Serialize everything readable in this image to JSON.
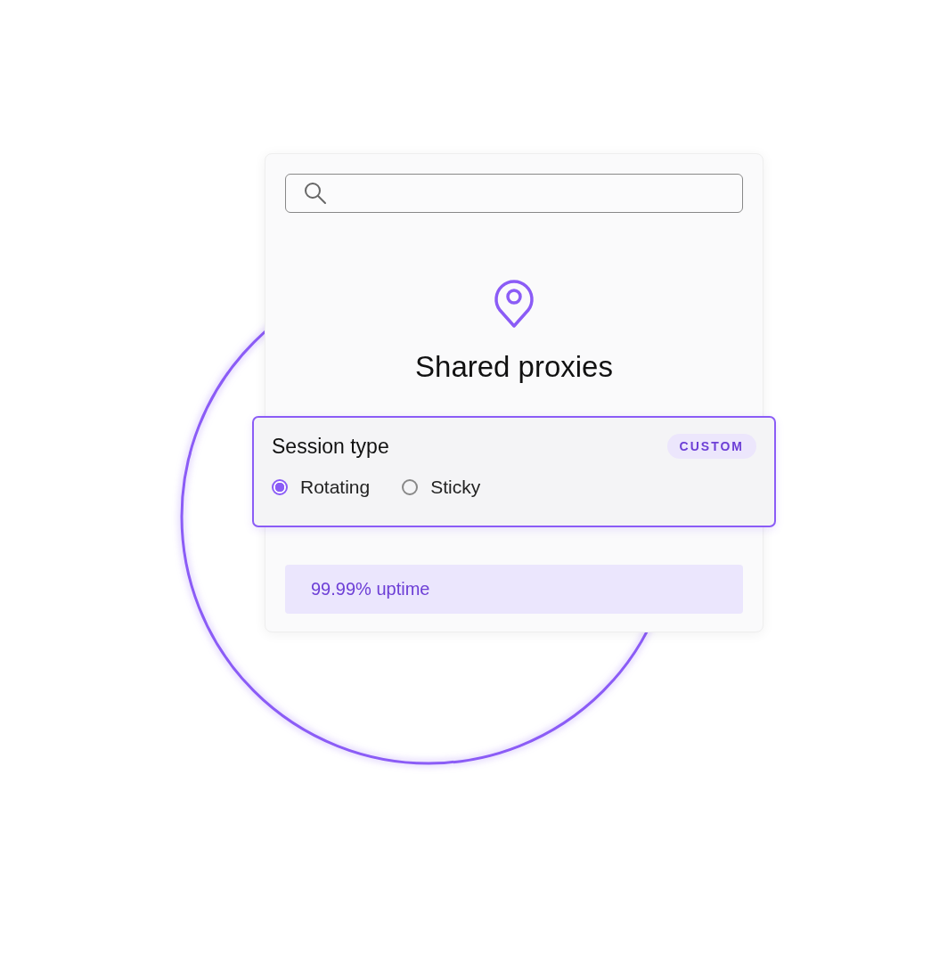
{
  "title": "Shared proxies",
  "session": {
    "label": "Session type",
    "badge": "CUSTOM",
    "options": [
      {
        "label": "Rotating",
        "selected": true
      },
      {
        "label": "Sticky",
        "selected": false
      }
    ]
  },
  "uptime": "99.99% uptime"
}
